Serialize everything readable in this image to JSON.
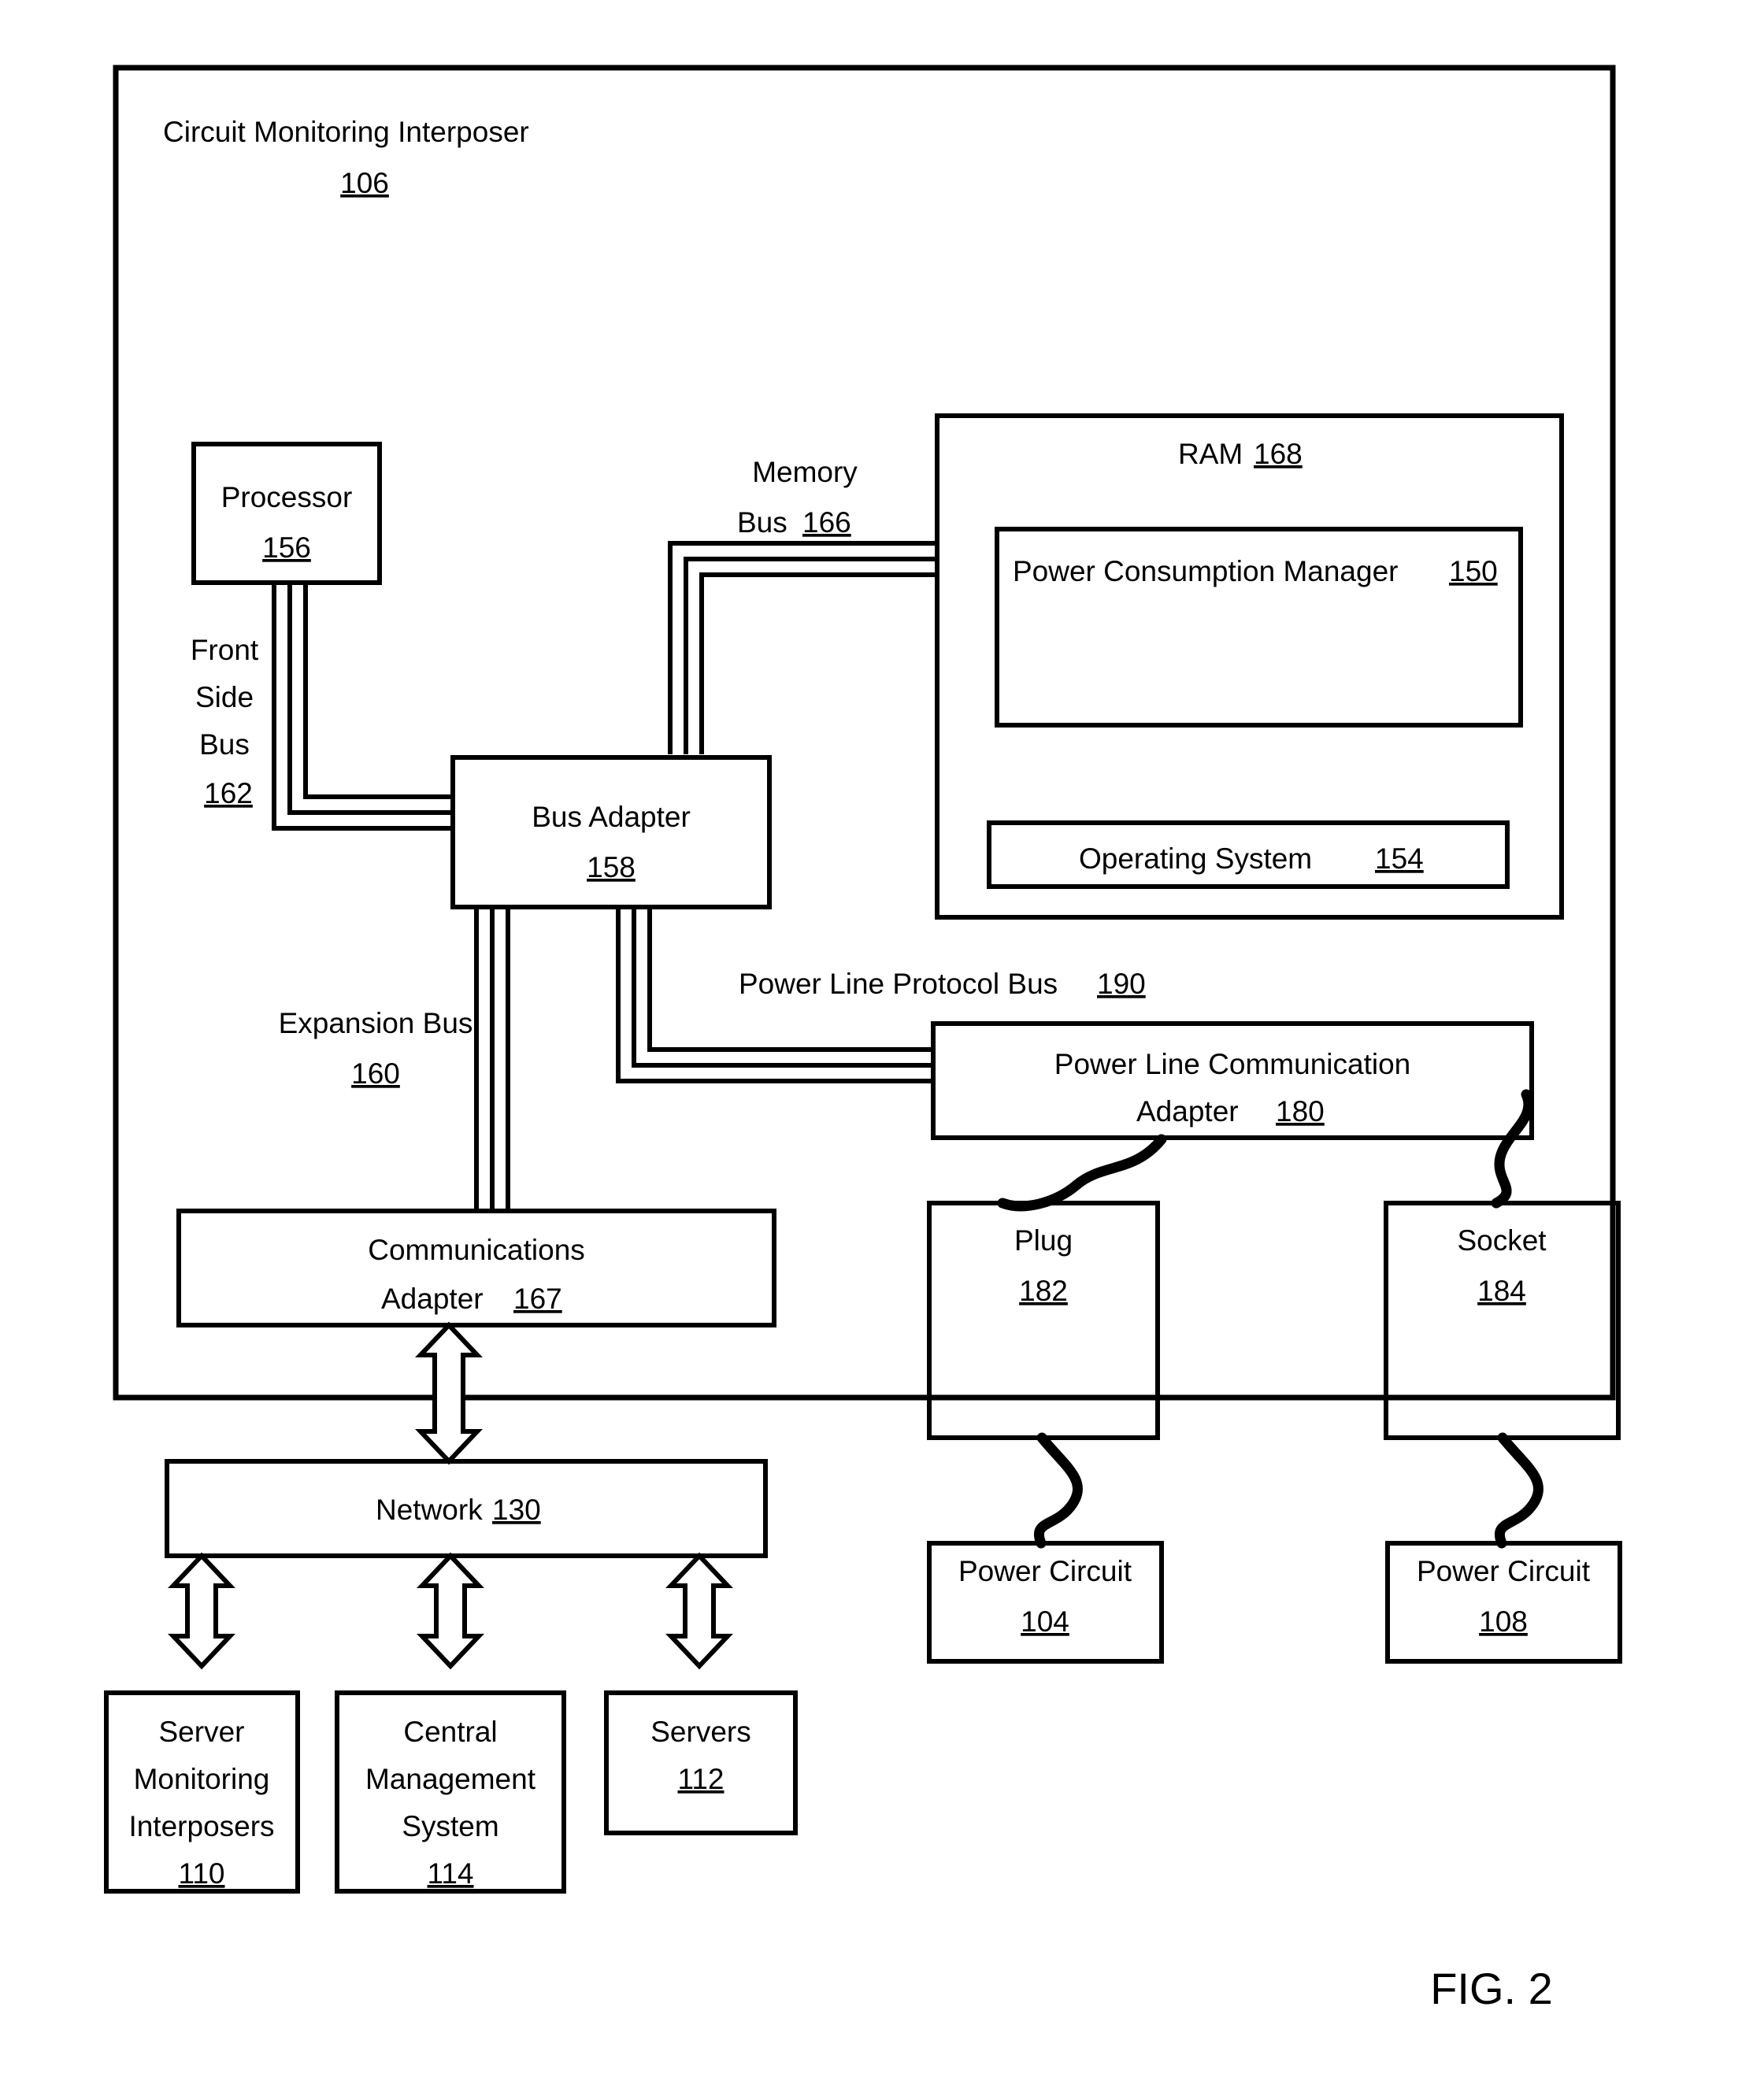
{
  "figure": {
    "caption": "FIG. 2"
  },
  "interposer": {
    "title": "Circuit Monitoring Interposer",
    "ref": "106"
  },
  "blocks": {
    "processor": {
      "label": "Processor",
      "ref": "156"
    },
    "bus_adapter": {
      "label": "Bus Adapter",
      "ref": "158"
    },
    "ram": {
      "label": "RAM",
      "ref": "168"
    },
    "power_consumption_manager": {
      "label": "Power Consumption Manager",
      "ref": "150"
    },
    "operating_system": {
      "label": "Operating System",
      "ref": "154"
    },
    "power_line_communication_adapter": {
      "label_line1": "Power Line Communication",
      "label_line2": "Adapter",
      "ref": "180"
    },
    "communications_adapter": {
      "label_line1": "Communications",
      "label_line2": "Adapter",
      "ref": "167"
    },
    "plug": {
      "label": "Plug",
      "ref": "182"
    },
    "socket": {
      "label": "Socket",
      "ref": "184"
    },
    "power_circuit_left": {
      "label": "Power Circuit",
      "ref": "104"
    },
    "power_circuit_right": {
      "label": "Power Circuit",
      "ref": "108"
    },
    "network": {
      "label": "Network",
      "ref": "130"
    },
    "server_monitoring_interposers": {
      "label_line1": "Server",
      "label_line2": "Monitoring",
      "label_line3": "Interposers",
      "ref": "110"
    },
    "central_management_system": {
      "label_line1": "Central",
      "label_line2": "Management",
      "label_line3": "System",
      "ref": "114"
    },
    "servers": {
      "label": "Servers",
      "ref": "112"
    }
  },
  "buses": {
    "front_side_bus": {
      "label_line1": "Front",
      "label_line2": "Side",
      "label_line3": "Bus",
      "ref": "162"
    },
    "memory_bus": {
      "label_line1": "Memory",
      "label_line2": "Bus",
      "ref": "166"
    },
    "expansion_bus": {
      "label": "Expansion Bus",
      "ref": "160"
    },
    "power_line_protocol_bus": {
      "label": "Power Line Protocol Bus",
      "ref": "190"
    }
  },
  "colors": {
    "stroke": "#000000",
    "background": "#ffffff"
  }
}
